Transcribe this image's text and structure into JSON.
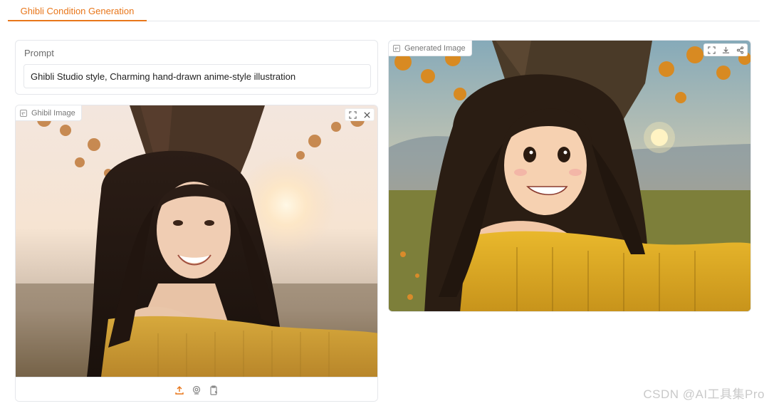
{
  "tabs": [
    {
      "label": "Ghibli Condition Generation",
      "active": true
    }
  ],
  "prompt": {
    "label": "Prompt",
    "value": "Ghibli Studio style, Charming hand-drawn anime-style illustration"
  },
  "input_image": {
    "label": "Ghibil Image",
    "toolbar": [
      "fullscreen-icon",
      "close-icon"
    ],
    "bottom_actions": [
      "upload-icon",
      "webcam-icon",
      "clipboard-icon"
    ]
  },
  "output_image": {
    "label": "Generated Image",
    "toolbar": [
      "fullscreen-icon",
      "download-icon",
      "share-icon"
    ]
  },
  "watermark": "CSDN @AI工具集Pro",
  "colors": {
    "accent": "#e8761a",
    "border": "#e5e7eb"
  }
}
